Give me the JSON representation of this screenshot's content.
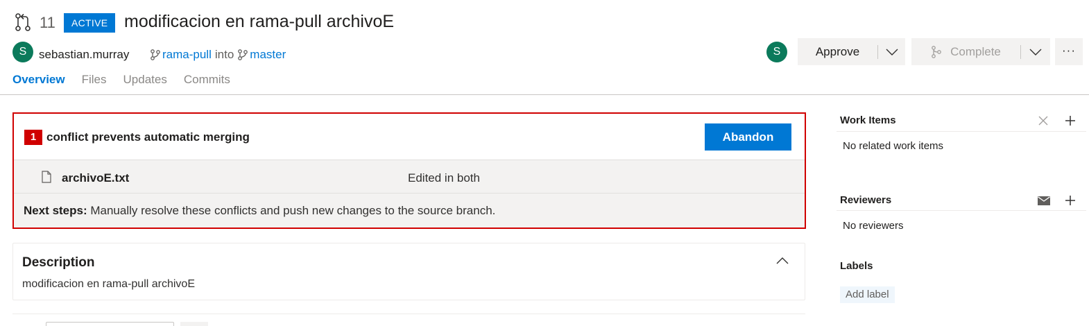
{
  "pull_request": {
    "id": "11",
    "status": "ACTIVE",
    "title": "modificacion en rama-pull archivoE",
    "author": {
      "initial": "S",
      "name": "sebastian.murray"
    },
    "source_branch": "rama-pull",
    "into": "into",
    "target_branch": "master"
  },
  "tabs": [
    {
      "label": "Overview",
      "active": true
    },
    {
      "label": "Files",
      "active": false
    },
    {
      "label": "Updates",
      "active": false
    },
    {
      "label": "Commits",
      "active": false
    }
  ],
  "actions": {
    "reviewer_initial": "S",
    "approve": "Approve",
    "complete": "Complete",
    "more": "···"
  },
  "conflict": {
    "count": "1",
    "message": "conflict prevents automatic merging",
    "abandon": "Abandon",
    "file_name": "archivoE.txt",
    "file_status": "Edited in both",
    "next_steps_label": "Next steps:",
    "next_steps_text": " Manually resolve these conflicts and push new changes to the source branch."
  },
  "description": {
    "title": "Description",
    "text": "modificacion en rama-pull archivoE"
  },
  "sidebar": {
    "work_items": {
      "title": "Work Items",
      "empty": "No related work items"
    },
    "reviewers": {
      "title": "Reviewers",
      "empty": "No reviewers"
    },
    "labels": {
      "title": "Labels",
      "add": "Add label"
    }
  },
  "colors": {
    "accent": "#0078d4",
    "conflict": "#d00000",
    "avatar": "#0b7a5b"
  }
}
